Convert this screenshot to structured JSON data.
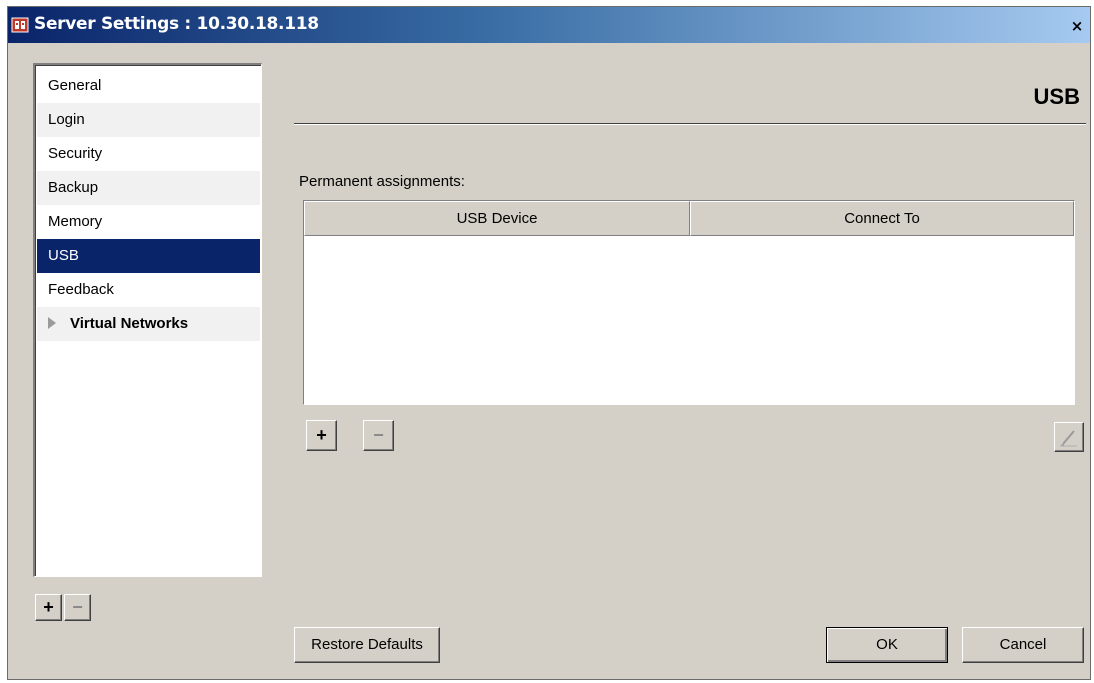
{
  "window": {
    "title": "Server Settings : 10.30.18.118",
    "close_label": "×"
  },
  "sidebar": {
    "items": [
      {
        "label": "General"
      },
      {
        "label": "Login"
      },
      {
        "label": "Security"
      },
      {
        "label": "Backup"
      },
      {
        "label": "Memory"
      },
      {
        "label": "USB",
        "selected": true
      },
      {
        "label": "Feedback"
      },
      {
        "label": "Virtual Networks",
        "group": true
      }
    ],
    "add_label": "+",
    "remove_label": "−"
  },
  "panel": {
    "title": "USB",
    "assignments_label": "Permanent assignments:",
    "table": {
      "columns": [
        "USB Device",
        "Connect To"
      ],
      "rows": []
    },
    "add_label": "+",
    "remove_label": "−"
  },
  "footer": {
    "restore_label": "Restore Defaults",
    "ok_label": "OK",
    "cancel_label": "Cancel"
  },
  "colors": {
    "selected_bg": "#0a246a",
    "dialog_bg": "#d4d0c8"
  },
  "icons": {
    "app": "server-settings-icon",
    "edit": "pencil-icon",
    "expand": "triangle-right-icon"
  }
}
